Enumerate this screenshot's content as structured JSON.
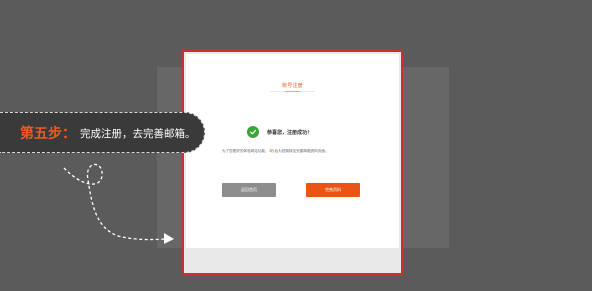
{
  "tutorial": {
    "step_label": "第五步：",
    "step_text": "完成注册，去完善邮箱。"
  },
  "card": {
    "title": "账号注册",
    "success_message": "恭喜您，注册成功！",
    "info_prefix": "为了您更好的体验网站功能，",
    "info_countdown": "3秒",
    "info_suffix": "后为您跳转至完善邮箱资料页面。",
    "home_button": "返回首页",
    "profile_button": "完善资料"
  },
  "colors": {
    "accent": "#e85b1c",
    "frame_border": "#c8322a",
    "success_green": "#3aa63a",
    "button_gray": "#8d8d8d",
    "button_orange": "#ea5514"
  },
  "icons": {
    "success": "check-circle-icon",
    "arrow": "dashed-arrow-icon"
  }
}
